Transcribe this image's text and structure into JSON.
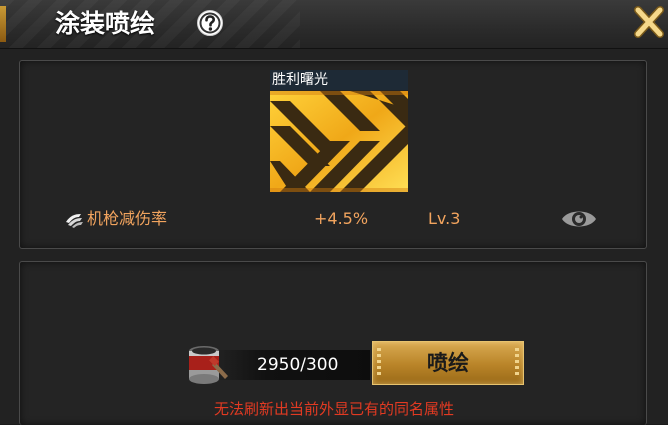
{
  "header": {
    "title": "涂装喷绘"
  },
  "skin": {
    "name": "胜利曙光"
  },
  "stat": {
    "name": "机枪减伤率",
    "value": "+4.5%",
    "level": "Lv.3"
  },
  "cost": {
    "text": "2950/300"
  },
  "spray_button": {
    "label": "喷绘"
  },
  "warning": {
    "text": "无法刷新出当前外显已有的同名属性"
  },
  "colors": {
    "accent": "#f2a45e",
    "button": "#c08a2c",
    "warning": "#e23a22"
  },
  "icons": {
    "help": "question-circle-icon",
    "close": "close-icon",
    "stat": "bullet-trail-icon",
    "preview": "eye-icon",
    "cost": "paint-bucket-icon"
  }
}
